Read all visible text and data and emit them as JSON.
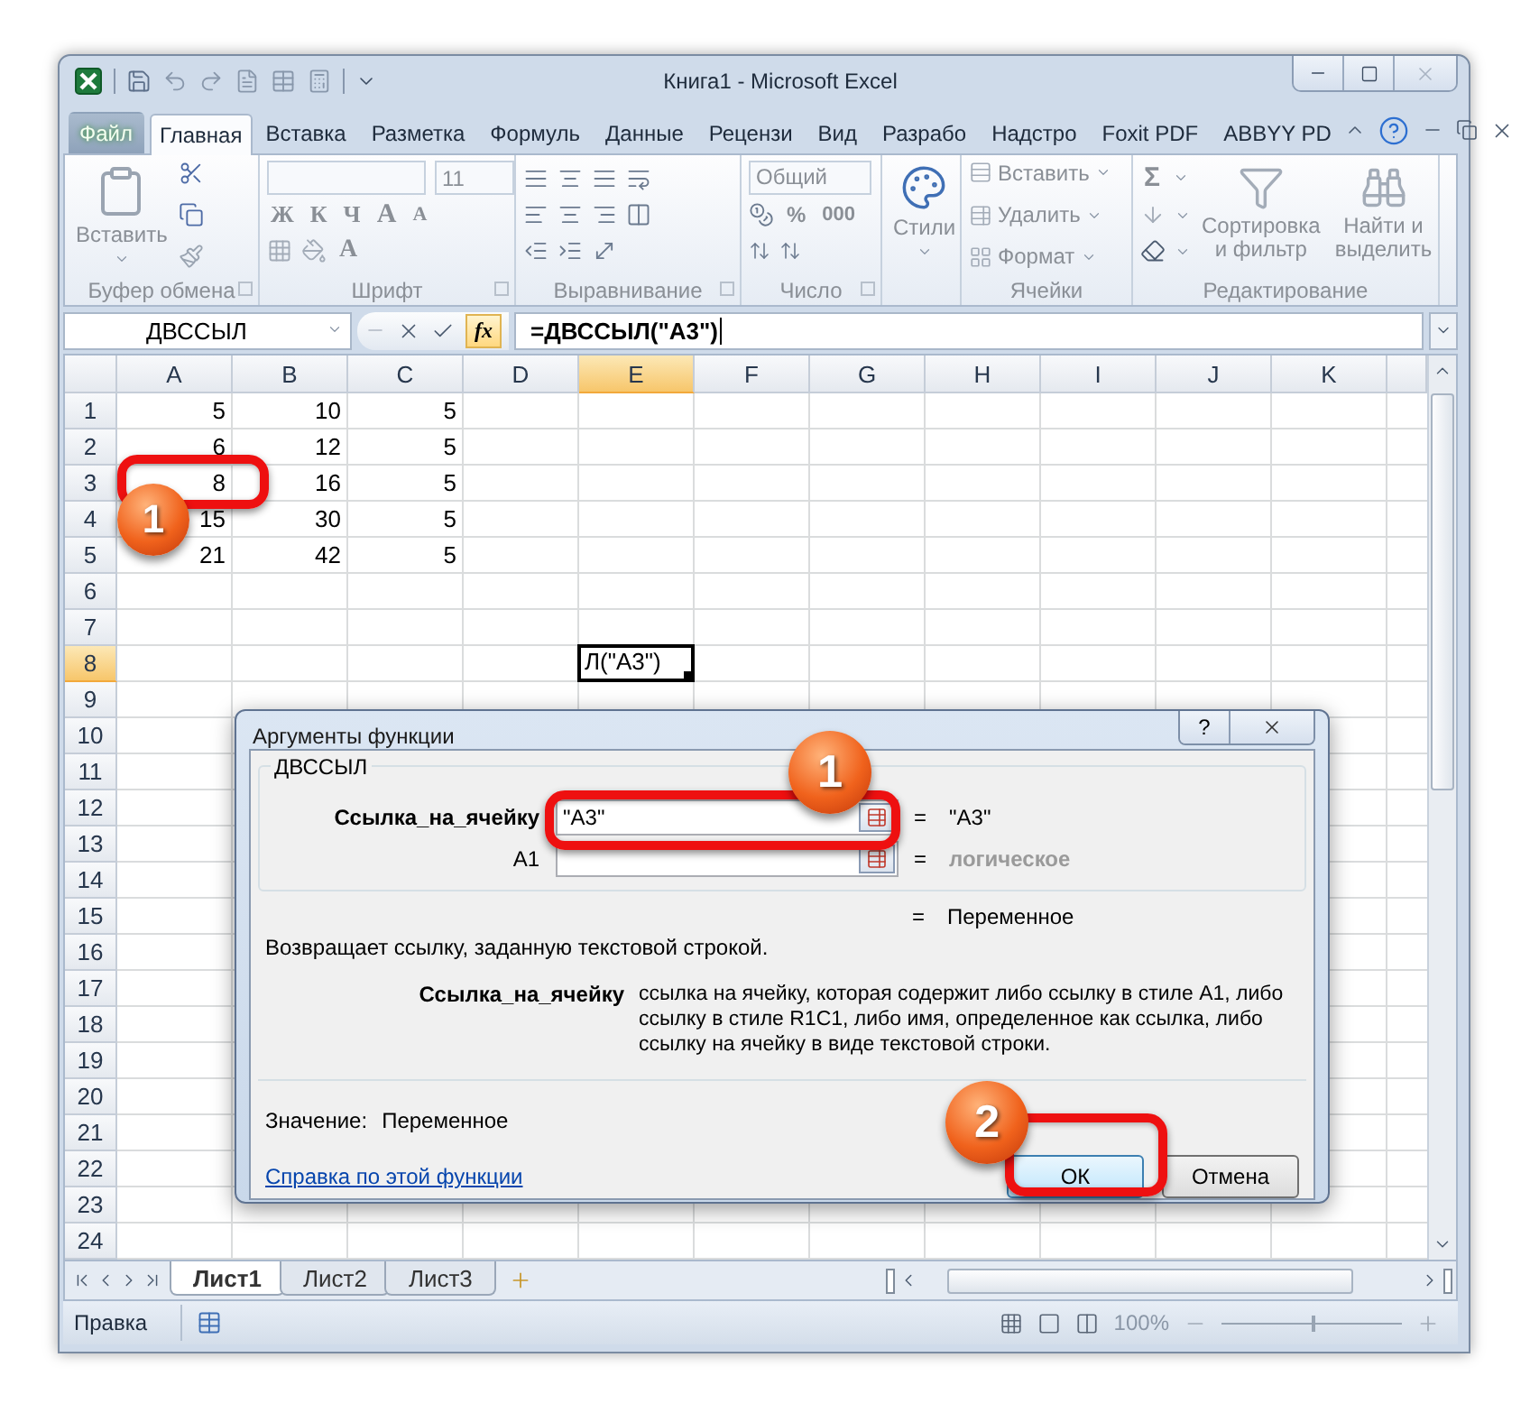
{
  "window": {
    "title": "Книга1 - Microsoft Excel"
  },
  "ribbon_tabs": [
    {
      "label": "Файл",
      "kind": "file",
      "selected": false
    },
    {
      "label": "Главная",
      "kind": "tab",
      "selected": true
    },
    {
      "label": "Вставка",
      "kind": "tab",
      "selected": false
    },
    {
      "label": "Разметка",
      "kind": "tab",
      "selected": false
    },
    {
      "label": "Формуль",
      "kind": "tab",
      "selected": false
    },
    {
      "label": "Данные",
      "kind": "tab",
      "selected": false
    },
    {
      "label": "Рецензи",
      "kind": "tab",
      "selected": false
    },
    {
      "label": "Вид",
      "kind": "tab",
      "selected": false
    },
    {
      "label": "Разрабо",
      "kind": "tab",
      "selected": false
    },
    {
      "label": "Надстро",
      "kind": "tab",
      "selected": false
    },
    {
      "label": "Foxit PDF",
      "kind": "tab",
      "selected": false
    },
    {
      "label": "ABBYY PD",
      "kind": "tab",
      "selected": false
    }
  ],
  "ribbon": {
    "disabled": true,
    "clipboard": {
      "paste": "Вставить",
      "footer": "Буфер обмена"
    },
    "font": {
      "size": "11",
      "style_buttons": [
        "Ж",
        "К",
        "Ч"
      ],
      "size_buttons": [
        "A",
        "A"
      ],
      "color_button": "A",
      "footer": "Шрифт"
    },
    "alignment": {
      "footer": "Выравнивание"
    },
    "number": {
      "format": "Общий",
      "percent": "%",
      "thousands": "000",
      "footer": "Число"
    },
    "styles": {
      "label": "Стили"
    },
    "cells": {
      "items": [
        "Вставить",
        "Удалить",
        "Формат"
      ],
      "footer": "Ячейки"
    },
    "editing": {
      "sum": "Σ",
      "sort": "Сортировка и фильтр",
      "find": "Найти и выделить",
      "footer": "Редактирование"
    }
  },
  "formula_bar": {
    "name_box": "ДВССЫЛ",
    "fx": "fx",
    "formula": "=ДВССЫЛ(\"А3\")"
  },
  "columns": [
    {
      "label": "A",
      "selected": false
    },
    {
      "label": "B",
      "selected": false
    },
    {
      "label": "C",
      "selected": false
    },
    {
      "label": "D",
      "selected": false
    },
    {
      "label": "E",
      "selected": true
    },
    {
      "label": "F",
      "selected": false
    },
    {
      "label": "G",
      "selected": false
    },
    {
      "label": "H",
      "selected": false
    },
    {
      "label": "I",
      "selected": false
    },
    {
      "label": "J",
      "selected": false
    },
    {
      "label": "K",
      "selected": false
    }
  ],
  "rows": [
    {
      "header": "1",
      "selected": false,
      "cells": [
        "5",
        "10",
        "5"
      ]
    },
    {
      "header": "2",
      "selected": false,
      "cells": [
        "6",
        "12",
        "5"
      ]
    },
    {
      "header": "3",
      "selected": false,
      "cells": [
        "8",
        "16",
        "5"
      ]
    },
    {
      "header": "4",
      "selected": false,
      "cells": [
        "15",
        "30",
        "5"
      ]
    },
    {
      "header": "5",
      "selected": false,
      "cells": [
        "21",
        "42",
        "5"
      ]
    },
    {
      "header": "6",
      "selected": false
    },
    {
      "header": "7",
      "selected": false
    },
    {
      "header": "8",
      "selected": true,
      "active_text": "Л(\"А3\")"
    },
    {
      "header": "9",
      "selected": false
    },
    {
      "header": "10",
      "selected": false
    },
    {
      "header": "11",
      "selected": false
    },
    {
      "header": "12",
      "selected": false
    },
    {
      "header": "13",
      "selected": false
    },
    {
      "header": "14",
      "selected": false
    },
    {
      "header": "15",
      "selected": false
    },
    {
      "header": "16",
      "selected": false
    },
    {
      "header": "17",
      "selected": false
    },
    {
      "header": "18",
      "selected": false
    },
    {
      "header": "19",
      "selected": false
    },
    {
      "header": "20",
      "selected": false
    },
    {
      "header": "21",
      "selected": false
    },
    {
      "header": "22",
      "selected": false
    },
    {
      "header": "23",
      "selected": false
    },
    {
      "header": "24",
      "selected": false
    }
  ],
  "sheet_tabs": [
    {
      "label": "Лист1",
      "selected": true
    },
    {
      "label": "Лист2",
      "selected": false
    },
    {
      "label": "Лист3",
      "selected": false
    }
  ],
  "status_bar": {
    "mode": "Правка",
    "zoom": {
      "label": "100%",
      "level": 0.5
    }
  },
  "dialog": {
    "title": "Аргументы функции",
    "help_button": "?",
    "function_name": "ДВССЫЛ",
    "arguments": [
      {
        "label": "Ссылка_на_ячейку",
        "required": true,
        "value": "\"А3\"",
        "equals": "=",
        "result": "\"А3\"",
        "result_muted": false
      },
      {
        "label": "A1",
        "required": false,
        "equals": "=",
        "result": "логическое",
        "result_muted": true
      }
    ],
    "result_equals": "=",
    "result": "Переменное",
    "description": "Возвращает ссылку, заданную текстовой строкой.",
    "argument_help": {
      "label": "Ссылка_на_ячейку",
      "text": "ссылка на ячейку, которая содержит либо ссылку в стиле А1, либо ссылку в стиле R1C1, либо имя, определенное как ссылка, либо ссылку на ячейку в виде текстовой строки."
    },
    "value_label": "Значение:",
    "value": "Переменное",
    "help_link": "Справка по этой функции",
    "buttons": [
      {
        "label": "ОК",
        "default": true
      },
      {
        "label": "Отмена",
        "default": false
      }
    ]
  },
  "callouts": [
    {
      "label": "1"
    },
    {
      "label": "1"
    },
    {
      "label": "2"
    }
  ]
}
